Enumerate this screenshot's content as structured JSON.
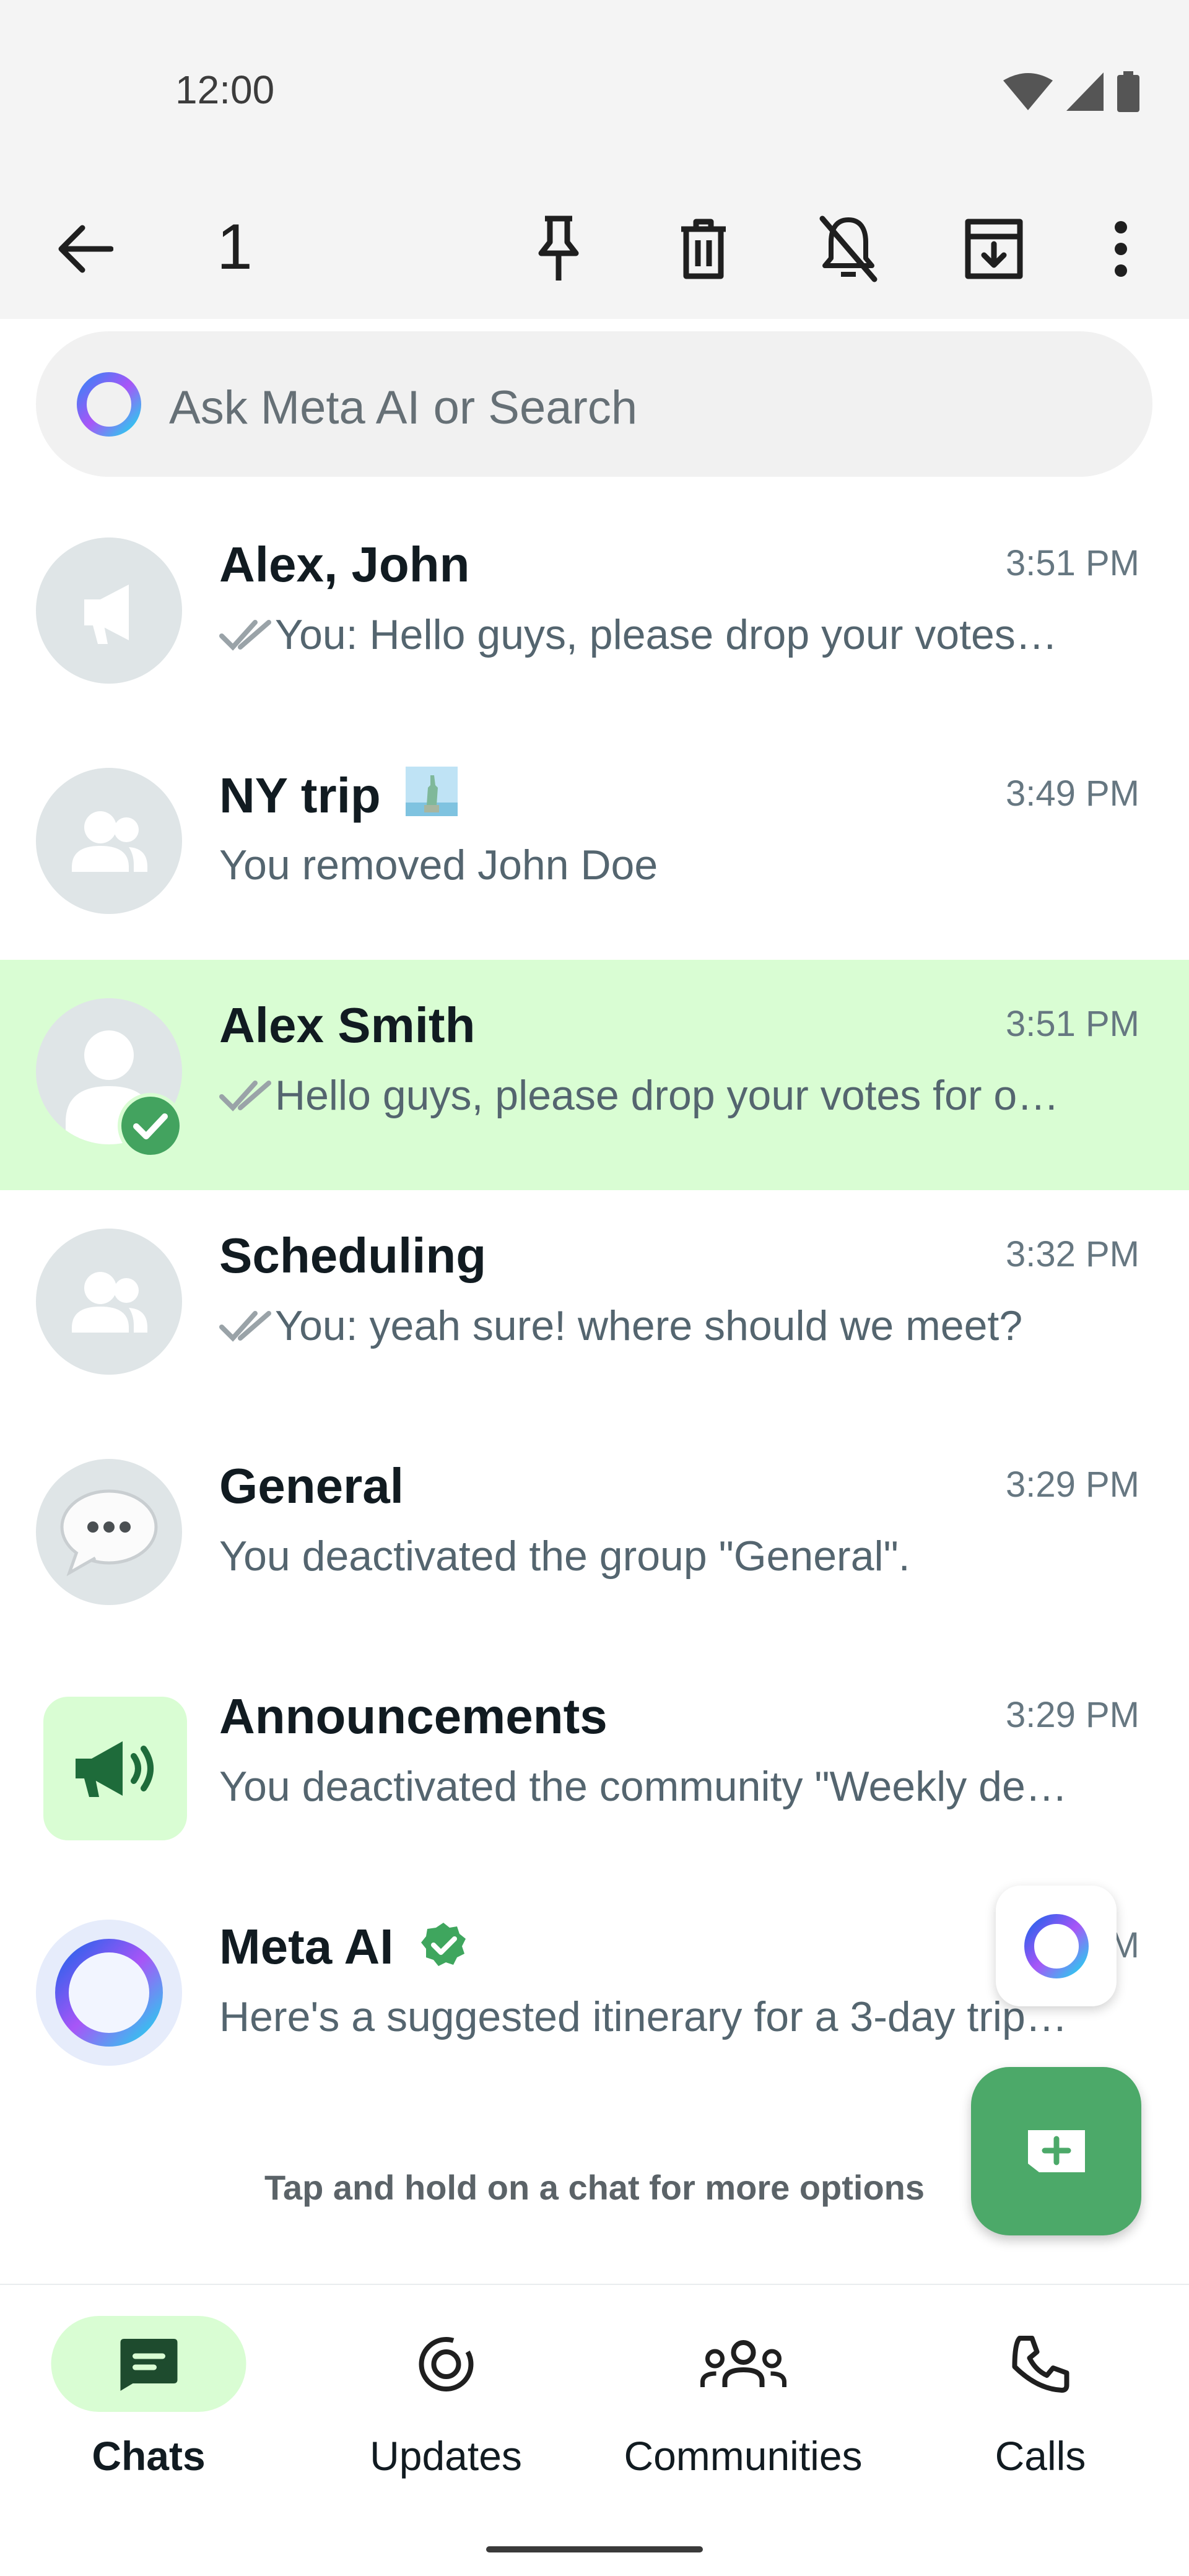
{
  "status_bar": {
    "time": "12:00"
  },
  "action_bar": {
    "selected_count": "1",
    "icons": [
      "back-arrow-icon",
      "pin-icon",
      "delete-icon",
      "mute-icon",
      "archive-icon",
      "more-vert-icon"
    ]
  },
  "search": {
    "placeholder": "Ask Meta AI or Search"
  },
  "chats": [
    {
      "name": "Alex, John",
      "time": "3:51 PM",
      "preview": "You: Hello guys, please drop your votes…",
      "ticks": true
    },
    {
      "name": "NY trip",
      "time": "3:49 PM",
      "preview": "You removed John Doe",
      "ticks": false
    },
    {
      "name": "Alex Smith",
      "time": "3:51 PM",
      "preview": "Hello guys, please drop your votes for o…",
      "ticks": true,
      "selected": true
    },
    {
      "name": "Scheduling",
      "time": "3:32 PM",
      "preview": "You: yeah sure! where should we meet?",
      "ticks": true
    },
    {
      "name": "General",
      "time": "3:29 PM",
      "preview": "You deactivated the group \"General\".",
      "ticks": false
    },
    {
      "name": "Announcements",
      "time": "3:29 PM",
      "preview": "You deactivated the community \"Weekly de…",
      "ticks": false
    },
    {
      "name": "Meta AI",
      "time": "PM",
      "preview": "Here's a suggested itinerary for a 3-day trip…",
      "ticks": false,
      "verified": true
    }
  ],
  "hint": "Tap and hold on a chat for more options",
  "bottom_nav": [
    {
      "label": "Chats",
      "active": true
    },
    {
      "label": "Updates",
      "active": false
    },
    {
      "label": "Communities",
      "active": false
    },
    {
      "label": "Calls",
      "active": false
    }
  ],
  "colors": {
    "accent": "#4ca969",
    "selected_row": "#d9fdd3",
    "app_bar": "#f4f4f4"
  }
}
